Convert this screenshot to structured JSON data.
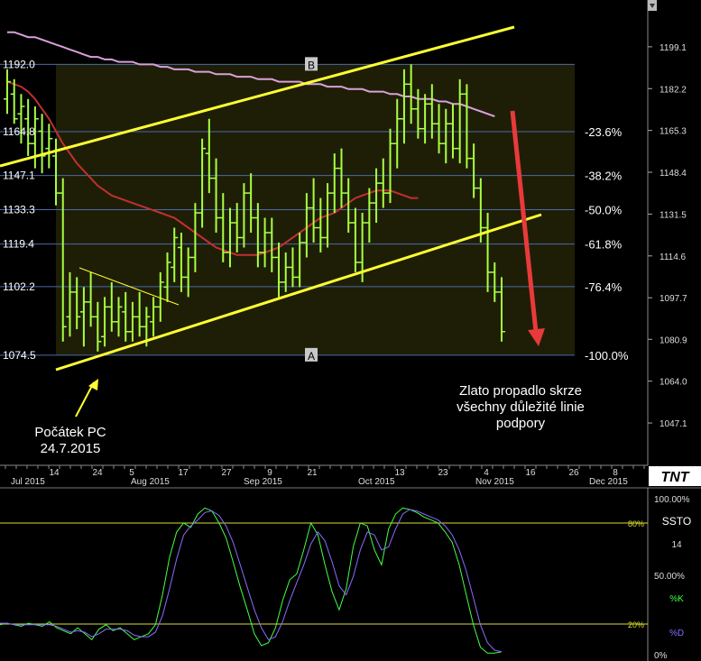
{
  "chart_data": [
    {
      "type": "ohlc-bar",
      "panel": "price",
      "x_tick_labels": [
        "14",
        "24",
        "5",
        "17",
        "27",
        "9",
        "21",
        "13",
        "23",
        "4",
        "16",
        "26",
        "8"
      ],
      "month_labels": [
        "Jul 2015",
        "Aug 2015",
        "Sep 2015",
        "Oct 2015",
        "Nov 2015",
        "Dec 2015"
      ],
      "right_axis_ticks": [
        "1199.1",
        "1182.2",
        "1165.3",
        "1148.4",
        "1131.5",
        "1114.6",
        "1097.7",
        "1080.9",
        "1064.0",
        "1047.1"
      ],
      "right_axis_values": [
        1199.1,
        1182.2,
        1165.3,
        1148.4,
        1131.5,
        1114.6,
        1097.7,
        1080.9,
        1064.0,
        1047.1
      ],
      "left_level_labels": [
        "1192.0",
        "1164.8",
        "1147.1",
        "1133.3",
        "1119.4",
        "1102.2",
        "1074.5"
      ],
      "left_level_values": [
        1192.0,
        1164.8,
        1147.1,
        1133.3,
        1119.4,
        1102.2,
        1074.5
      ],
      "fib_labels": [
        "-23.6%",
        "-38.2%",
        "-50.0%",
        "-61.8%",
        "-76.4%",
        "-100.0%"
      ],
      "fib_values": [
        1164.8,
        1147.1,
        1133.3,
        1119.4,
        1102.2,
        1074.5
      ],
      "fib_point_labels": [
        "B",
        "A"
      ],
      "ylim": [
        1030,
        1218
      ],
      "ohlc": [
        [
          1178,
          1190,
          1172,
          1185
        ],
        [
          1180,
          1186,
          1168,
          1170
        ],
        [
          1172,
          1180,
          1160,
          1175
        ],
        [
          1170,
          1178,
          1155,
          1160
        ],
        [
          1160,
          1175,
          1150,
          1170
        ],
        [
          1165,
          1172,
          1148,
          1155
        ],
        [
          1158,
          1168,
          1150,
          1162
        ],
        [
          1155,
          1162,
          1135,
          1140
        ],
        [
          1140,
          1146,
          1080,
          1086
        ],
        [
          1090,
          1108,
          1082,
          1100
        ],
        [
          1100,
          1106,
          1085,
          1090
        ],
        [
          1092,
          1102,
          1078,
          1096
        ],
        [
          1096,
          1108,
          1086,
          1090
        ],
        [
          1090,
          1096,
          1076,
          1080
        ],
        [
          1082,
          1098,
          1078,
          1094
        ],
        [
          1094,
          1104,
          1084,
          1088
        ],
        [
          1088,
          1098,
          1082,
          1094
        ],
        [
          1092,
          1100,
          1080,
          1084
        ],
        [
          1084,
          1096,
          1080,
          1090
        ],
        [
          1090,
          1100,
          1082,
          1086
        ],
        [
          1086,
          1094,
          1078,
          1090
        ],
        [
          1088,
          1098,
          1082,
          1094
        ],
        [
          1094,
          1108,
          1088,
          1104
        ],
        [
          1102,
          1116,
          1096,
          1112
        ],
        [
          1110,
          1126,
          1104,
          1122
        ],
        [
          1118,
          1124,
          1100,
          1106
        ],
        [
          1106,
          1118,
          1098,
          1114
        ],
        [
          1114,
          1136,
          1108,
          1132
        ],
        [
          1132,
          1162,
          1126,
          1158
        ],
        [
          1156,
          1170,
          1140,
          1146
        ],
        [
          1146,
          1154,
          1124,
          1130
        ],
        [
          1130,
          1140,
          1112,
          1116
        ],
        [
          1116,
          1134,
          1110,
          1128
        ],
        [
          1128,
          1136,
          1116,
          1122
        ],
        [
          1122,
          1144,
          1118,
          1140
        ],
        [
          1140,
          1148,
          1124,
          1130
        ],
        [
          1130,
          1136,
          1110,
          1116
        ],
        [
          1116,
          1130,
          1110,
          1124
        ],
        [
          1124,
          1130,
          1108,
          1114
        ],
        [
          1114,
          1120,
          1098,
          1104
        ],
        [
          1104,
          1116,
          1100,
          1110
        ],
        [
          1110,
          1118,
          1102,
          1106
        ],
        [
          1106,
          1124,
          1102,
          1120
        ],
        [
          1120,
          1140,
          1114,
          1134
        ],
        [
          1134,
          1146,
          1120,
          1126
        ],
        [
          1126,
          1138,
          1116,
          1122
        ],
        [
          1122,
          1144,
          1118,
          1140
        ],
        [
          1140,
          1156,
          1132,
          1150
        ],
        [
          1150,
          1158,
          1134,
          1140
        ],
        [
          1140,
          1146,
          1124,
          1128
        ],
        [
          1128,
          1134,
          1108,
          1112
        ],
        [
          1112,
          1132,
          1104,
          1128
        ],
        [
          1128,
          1142,
          1120,
          1136
        ],
        [
          1136,
          1150,
          1128,
          1144
        ],
        [
          1144,
          1154,
          1134,
          1140
        ],
        [
          1140,
          1166,
          1136,
          1160
        ],
        [
          1160,
          1178,
          1150,
          1170
        ],
        [
          1170,
          1190,
          1160,
          1184
        ],
        [
          1184,
          1192,
          1168,
          1174
        ],
        [
          1174,
          1182,
          1162,
          1166
        ],
        [
          1166,
          1180,
          1160,
          1176
        ],
        [
          1176,
          1184,
          1162,
          1168
        ],
        [
          1168,
          1176,
          1156,
          1160
        ],
        [
          1160,
          1174,
          1152,
          1168
        ],
        [
          1168,
          1176,
          1154,
          1158
        ],
        [
          1158,
          1186,
          1152,
          1180
        ],
        [
          1180,
          1184,
          1150,
          1154
        ],
        [
          1154,
          1160,
          1138,
          1142
        ],
        [
          1142,
          1146,
          1120,
          1126
        ],
        [
          1126,
          1132,
          1100,
          1108
        ],
        [
          1108,
          1112,
          1096,
          1100
        ],
        [
          1100,
          1106,
          1080,
          1084
        ]
      ],
      "ma_series": [
        {
          "color": "#d9a0d9",
          "values": [
            1205,
            1205,
            1204,
            1203,
            1203,
            1202,
            1201,
            1200,
            1199,
            1198,
            1197,
            1196,
            1195,
            1195,
            1194,
            1194,
            1193,
            1193,
            1193,
            1192,
            1192,
            1192,
            1191,
            1191,
            1190,
            1190,
            1190,
            1189,
            1189,
            1189,
            1188,
            1188,
            1188,
            1187,
            1187,
            1187,
            1186,
            1186,
            1186,
            1185,
            1185,
            1185,
            1185,
            1184,
            1184,
            1184,
            1183,
            1183,
            1183,
            1182,
            1182,
            1182,
            1181,
            1181,
            1181,
            1180,
            1180,
            1179,
            1179,
            1178,
            1178,
            1178,
            1177,
            1177,
            1176,
            1176,
            1175,
            1174,
            1173,
            1172,
            1171
          ]
        },
        {
          "color": "#c03030",
          "values": [
            1185,
            1184,
            1183,
            1181,
            1178,
            1174,
            1170,
            1165,
            1160,
            1156,
            1152,
            1149,
            1146,
            1143,
            1141,
            1139,
            1138,
            1137,
            1136,
            1135,
            1134,
            1133,
            1132,
            1131,
            1130,
            1128,
            1126,
            1124,
            1122,
            1120,
            1118,
            1117,
            1116,
            1115,
            1115,
            1115,
            1115,
            1116,
            1117,
            1118,
            1120,
            1122,
            1124,
            1126,
            1128,
            1130,
            1131,
            1132,
            1134,
            1136,
            1138,
            1139,
            1140,
            1141,
            1141,
            1141,
            1140,
            1139,
            1138,
            1138
          ]
        }
      ],
      "trend_lines": [
        {
          "color": "#ffff33",
          "from": [
            0,
            1147
          ],
          "to": [
            71,
            1211
          ]
        },
        {
          "color": "#ffff33",
          "from": [
            7,
            1072
          ],
          "to": [
            71,
            1133
          ]
        },
        {
          "color": "#ffff33",
          "from": [
            8,
            1107
          ],
          "to": [
            23,
            1096
          ]
        }
      ],
      "annotations": [
        {
          "text_lines": [
            "Počátek PC",
            "24.7.2015"
          ]
        },
        {
          "text_lines": [
            "Zlato propadlo skrze",
            "všechny důležité linie",
            "podpory"
          ]
        }
      ],
      "logo": "TNT"
    },
    {
      "type": "line",
      "panel": "oscillator",
      "title": "SSTO",
      "period": "14",
      "right_axis_ticks": [
        "100.00%",
        "50.00%",
        "0%"
      ],
      "levels": [
        80,
        20
      ],
      "level_labels": [
        "80%",
        "20%"
      ],
      "ylim": [
        0,
        100
      ],
      "series": [
        {
          "name": "%K",
          "color": "#44ff44",
          "values": [
            20,
            21,
            20,
            19,
            21,
            20,
            19,
            22,
            18,
            16,
            14,
            18,
            14,
            10,
            17,
            20,
            16,
            18,
            14,
            10,
            12,
            14,
            20,
            40,
            65,
            82,
            88,
            85,
            94,
            98,
            96,
            88,
            78,
            62,
            45,
            30,
            14,
            6,
            8,
            18,
            36,
            50,
            54,
            70,
            88,
            80,
            60,
            42,
            30,
            44,
            72,
            88,
            86,
            70,
            60,
            84,
            94,
            98,
            97,
            95,
            92,
            90,
            88,
            82,
            75,
            60,
            40,
            20,
            5,
            1,
            1,
            2
          ]
        },
        {
          "name": "%D",
          "color": "#8a6bff",
          "values": [
            21,
            21,
            20,
            20,
            20,
            20,
            20,
            20,
            19,
            17,
            15,
            16,
            15,
            12,
            14,
            17,
            17,
            17,
            16,
            13,
            12,
            12,
            15,
            26,
            44,
            64,
            80,
            86,
            90,
            95,
            96,
            93,
            86,
            75,
            60,
            45,
            30,
            18,
            10,
            12,
            22,
            36,
            48,
            60,
            74,
            82,
            76,
            62,
            46,
            40,
            52,
            70,
            82,
            80,
            70,
            72,
            84,
            94,
            97,
            96,
            94,
            92,
            90,
            86,
            80,
            70,
            56,
            38,
            20,
            8,
            3,
            2
          ]
        }
      ]
    }
  ]
}
